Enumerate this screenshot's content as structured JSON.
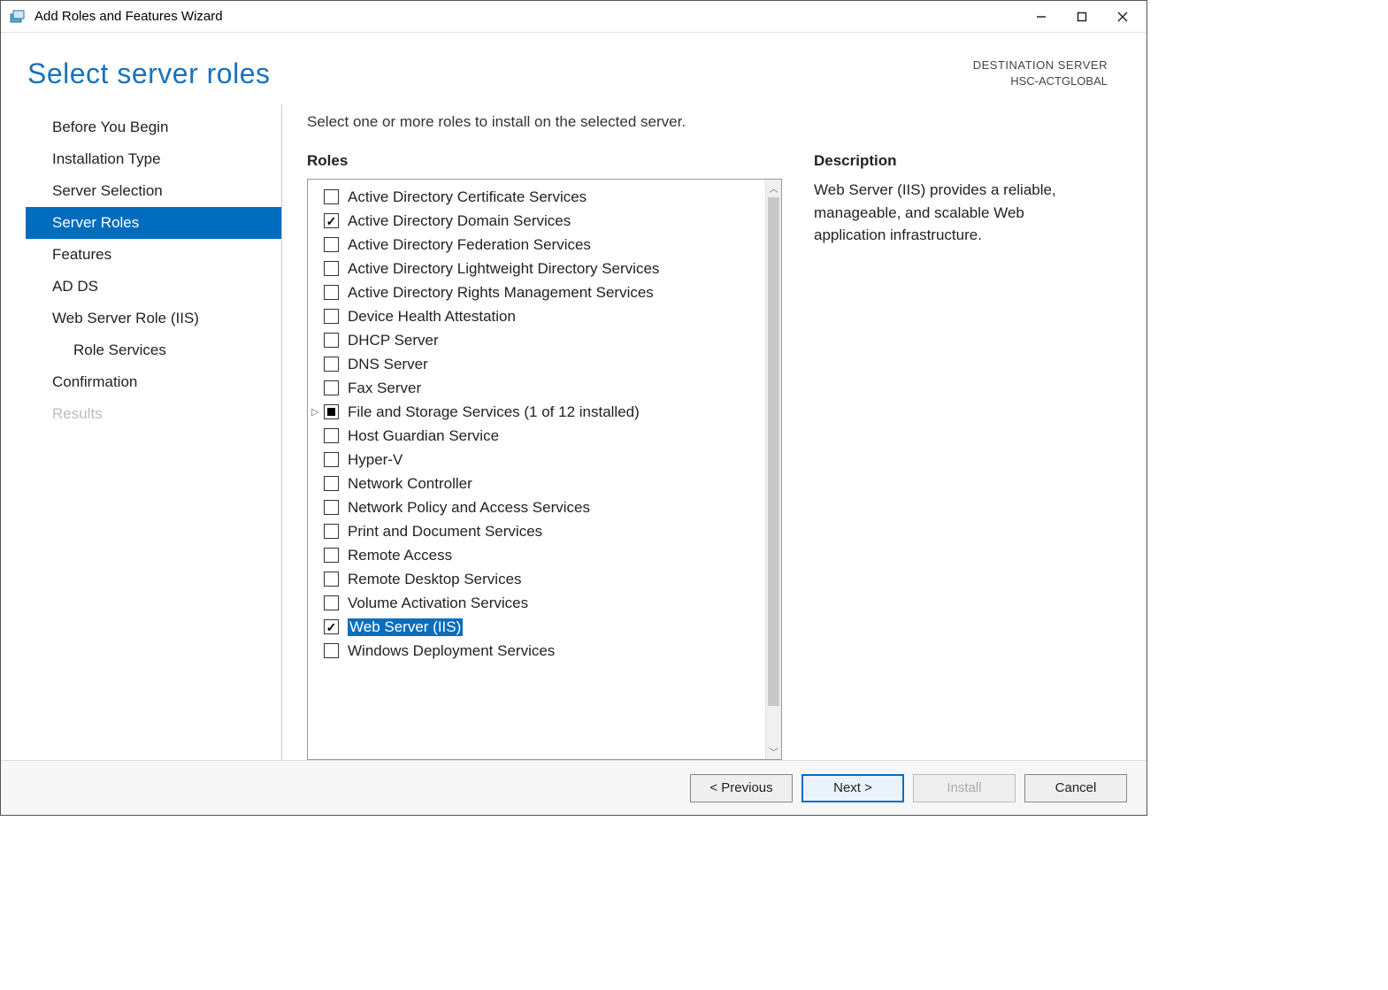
{
  "titlebar": {
    "title": "Add Roles and Features Wizard"
  },
  "header": {
    "page_title": "Select server roles",
    "dest_label": "DESTINATION SERVER",
    "dest_value": "HSC-ACTGLOBAL"
  },
  "sidebar": {
    "items": [
      {
        "label": "Before You Begin",
        "selected": false,
        "sub": false,
        "disabled": false
      },
      {
        "label": "Installation Type",
        "selected": false,
        "sub": false,
        "disabled": false
      },
      {
        "label": "Server Selection",
        "selected": false,
        "sub": false,
        "disabled": false
      },
      {
        "label": "Server Roles",
        "selected": true,
        "sub": false,
        "disabled": false
      },
      {
        "label": "Features",
        "selected": false,
        "sub": false,
        "disabled": false
      },
      {
        "label": "AD DS",
        "selected": false,
        "sub": false,
        "disabled": false
      },
      {
        "label": "Web Server Role (IIS)",
        "selected": false,
        "sub": false,
        "disabled": false
      },
      {
        "label": "Role Services",
        "selected": false,
        "sub": true,
        "disabled": false
      },
      {
        "label": "Confirmation",
        "selected": false,
        "sub": false,
        "disabled": false
      },
      {
        "label": "Results",
        "selected": false,
        "sub": false,
        "disabled": true
      }
    ]
  },
  "main": {
    "instruction": "Select one or more roles to install on the selected server.",
    "roles_header": "Roles",
    "desc_header": "Description",
    "description": "Web Server (IIS) provides a reliable, manageable, and scalable Web application infrastructure.",
    "roles": [
      {
        "label": "Active Directory Certificate Services",
        "state": "unchecked",
        "expandable": false,
        "selected": false
      },
      {
        "label": "Active Directory Domain Services",
        "state": "checked",
        "expandable": false,
        "selected": false
      },
      {
        "label": "Active Directory Federation Services",
        "state": "unchecked",
        "expandable": false,
        "selected": false
      },
      {
        "label": "Active Directory Lightweight Directory Services",
        "state": "unchecked",
        "expandable": false,
        "selected": false
      },
      {
        "label": "Active Directory Rights Management Services",
        "state": "unchecked",
        "expandable": false,
        "selected": false
      },
      {
        "label": "Device Health Attestation",
        "state": "unchecked",
        "expandable": false,
        "selected": false
      },
      {
        "label": "DHCP Server",
        "state": "unchecked",
        "expandable": false,
        "selected": false
      },
      {
        "label": "DNS Server",
        "state": "unchecked",
        "expandable": false,
        "selected": false
      },
      {
        "label": "Fax Server",
        "state": "unchecked",
        "expandable": false,
        "selected": false
      },
      {
        "label": "File and Storage Services (1 of 12 installed)",
        "state": "partial",
        "expandable": true,
        "selected": false
      },
      {
        "label": "Host Guardian Service",
        "state": "unchecked",
        "expandable": false,
        "selected": false
      },
      {
        "label": "Hyper-V",
        "state": "unchecked",
        "expandable": false,
        "selected": false
      },
      {
        "label": "Network Controller",
        "state": "unchecked",
        "expandable": false,
        "selected": false
      },
      {
        "label": "Network Policy and Access Services",
        "state": "unchecked",
        "expandable": false,
        "selected": false
      },
      {
        "label": "Print and Document Services",
        "state": "unchecked",
        "expandable": false,
        "selected": false
      },
      {
        "label": "Remote Access",
        "state": "unchecked",
        "expandable": false,
        "selected": false
      },
      {
        "label": "Remote Desktop Services",
        "state": "unchecked",
        "expandable": false,
        "selected": false
      },
      {
        "label": "Volume Activation Services",
        "state": "unchecked",
        "expandable": false,
        "selected": false
      },
      {
        "label": "Web Server (IIS)",
        "state": "checked",
        "expandable": false,
        "selected": true
      },
      {
        "label": "Windows Deployment Services",
        "state": "unchecked",
        "expandable": false,
        "selected": false
      }
    ]
  },
  "footer": {
    "previous": "< Previous",
    "next": "Next >",
    "install": "Install",
    "cancel": "Cancel"
  }
}
